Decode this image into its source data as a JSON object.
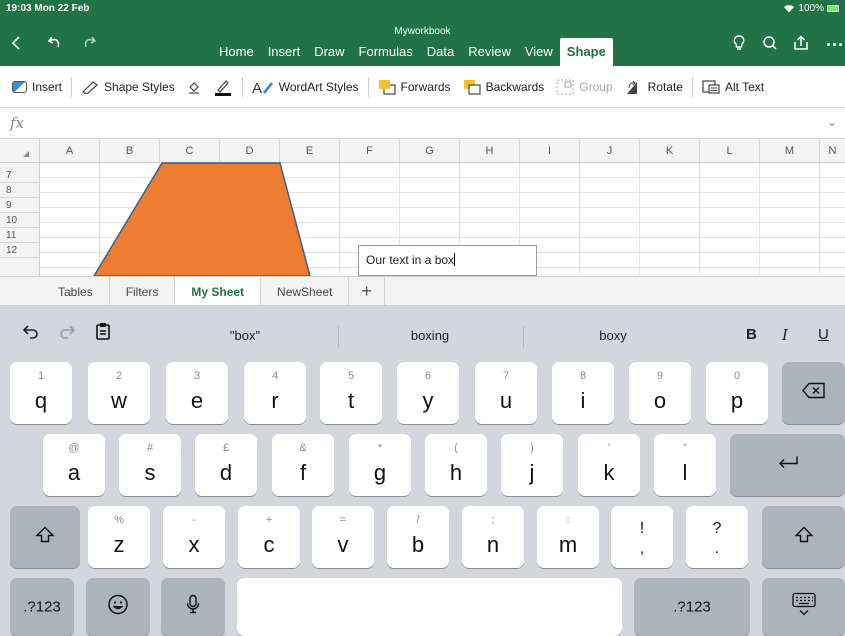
{
  "status": {
    "time": "19:03",
    "date": "Mon 22 Feb",
    "battery": "100%"
  },
  "document": {
    "title": "Myworkbook"
  },
  "menu_tabs": [
    "Home",
    "Insert",
    "Draw",
    "Formulas",
    "Data",
    "Review",
    "View",
    "Shape"
  ],
  "active_menu_tab": "Shape",
  "ribbon": {
    "insert": "Insert",
    "shape_styles": "Shape Styles",
    "wordart_styles": "WordArt Styles",
    "forwards": "Forwards",
    "backwards": "Backwards",
    "group": "Group",
    "rotate": "Rotate",
    "alt_text": "Alt Text"
  },
  "formula_bar": {
    "label": "fx",
    "value": ""
  },
  "columns": [
    "A",
    "B",
    "C",
    "D",
    "E",
    "F",
    "G",
    "H",
    "I",
    "J",
    "K",
    "L",
    "M",
    "N"
  ],
  "rows": [
    "7",
    "8",
    "9",
    "10",
    "11",
    "12"
  ],
  "shape": {
    "type": "trapezoid",
    "fill": "#ed7d31"
  },
  "textbox": {
    "text": "Our text in a box"
  },
  "sheet_tabs": [
    "Tables",
    "Filters",
    "My Sheet",
    "NewSheet"
  ],
  "active_sheet": "My Sheet",
  "keyboard": {
    "suggestions": [
      "\"box\"",
      "boxing",
      "boxy"
    ],
    "format": {
      "bold": "B",
      "italic": "I",
      "underline": "U"
    },
    "row1": [
      {
        "sub": "1",
        "main": "q"
      },
      {
        "sub": "2",
        "main": "w"
      },
      {
        "sub": "3",
        "main": "e"
      },
      {
        "sub": "4",
        "main": "r"
      },
      {
        "sub": "5",
        "main": "t"
      },
      {
        "sub": "6",
        "main": "y"
      },
      {
        "sub": "7",
        "main": "u"
      },
      {
        "sub": "8",
        "main": "i"
      },
      {
        "sub": "9",
        "main": "o"
      },
      {
        "sub": "0",
        "main": "p"
      }
    ],
    "row2": [
      {
        "sub": "@",
        "main": "a"
      },
      {
        "sub": "#",
        "main": "s"
      },
      {
        "sub": "£",
        "main": "d"
      },
      {
        "sub": "&",
        "main": "f"
      },
      {
        "sub": "*",
        "main": "g"
      },
      {
        "sub": "(",
        "main": "h"
      },
      {
        "sub": ")",
        "main": "j"
      },
      {
        "sub": "’",
        "main": "k"
      },
      {
        "sub": "”",
        "main": "l"
      }
    ],
    "row3": [
      {
        "sub": "%",
        "main": "z"
      },
      {
        "sub": "-",
        "main": "x"
      },
      {
        "sub": "+",
        "main": "c"
      },
      {
        "sub": "=",
        "main": "v"
      },
      {
        "sub": "/",
        "main": "b"
      },
      {
        "sub": ";",
        "main": "n"
      },
      {
        "sub": ":",
        "main": "m"
      },
      {
        "sub": "!",
        "main": ","
      },
      {
        "sub": "?",
        "main": "."
      }
    ],
    "numbers_key": ".?123",
    "return_glyph": "⏎",
    "shift_glyph": "⇧"
  }
}
